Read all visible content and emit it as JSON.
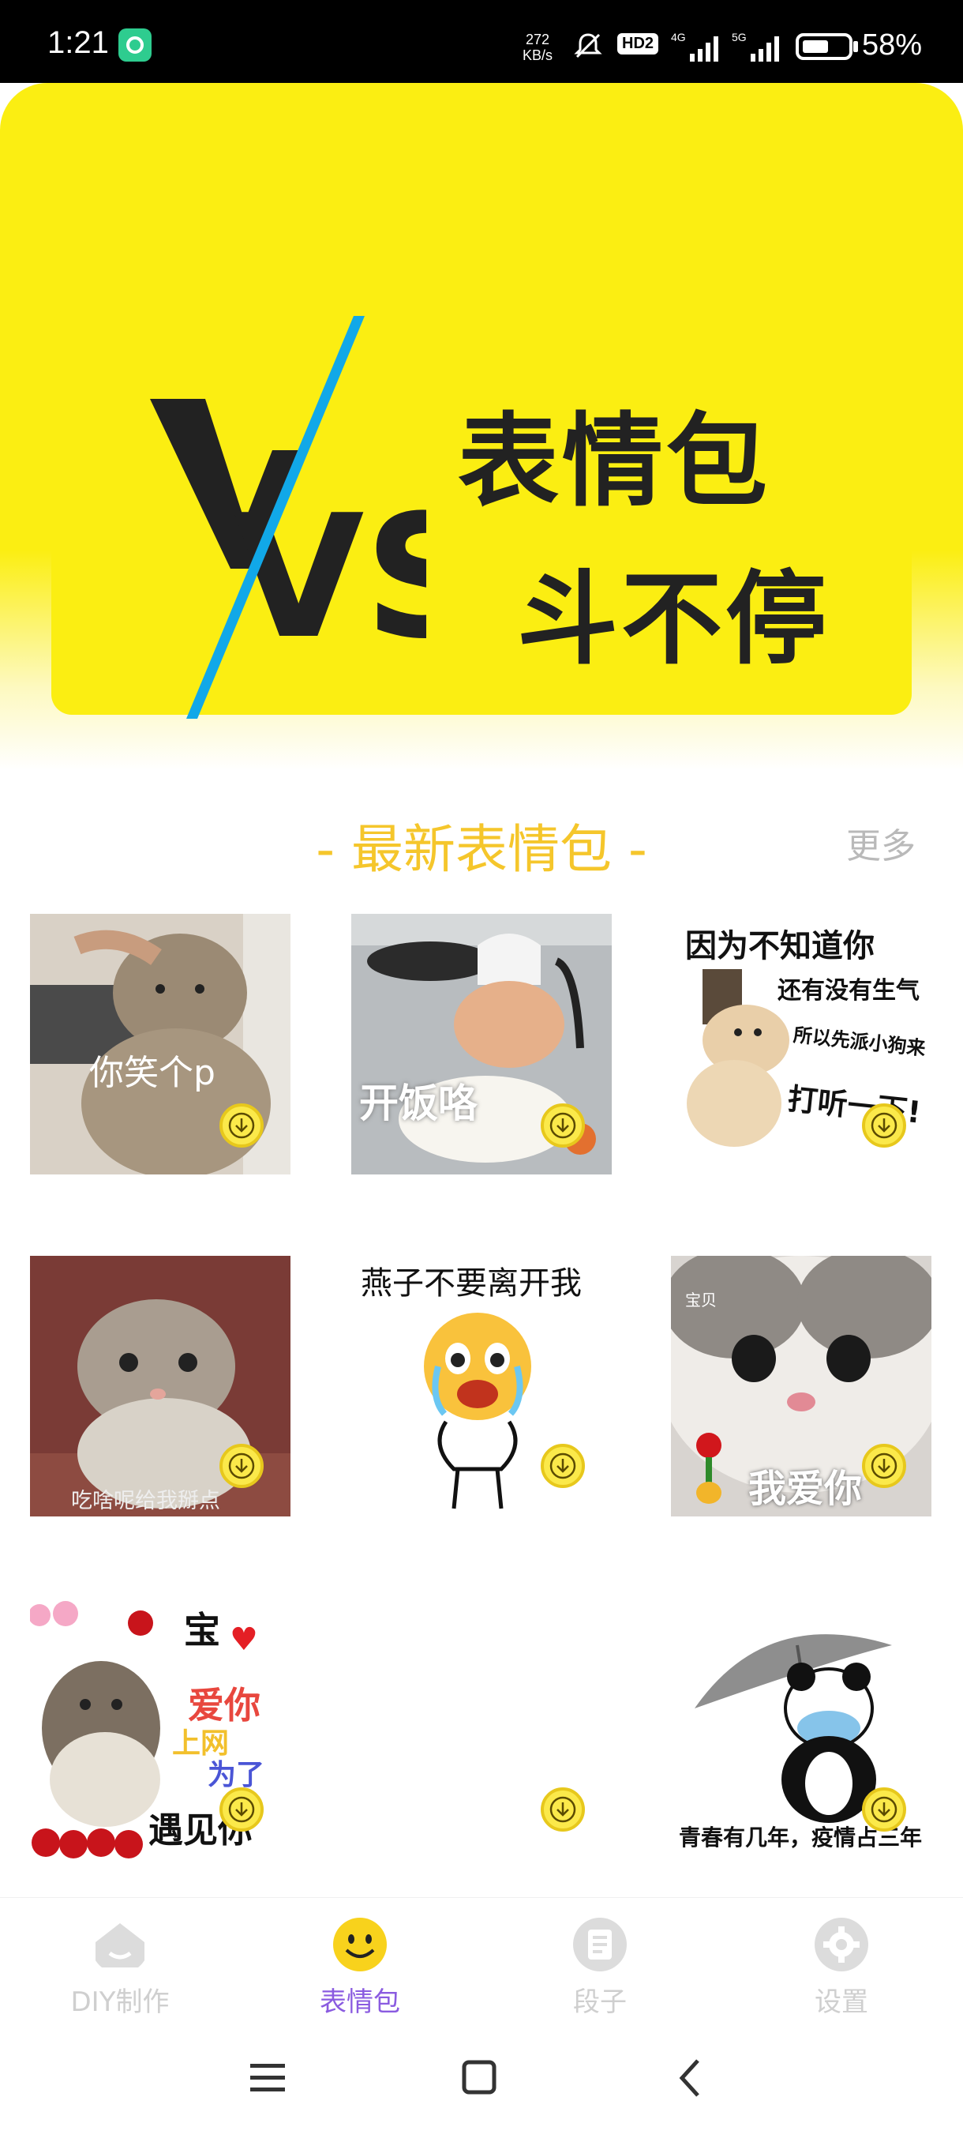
{
  "status_bar": {
    "time": "1:21",
    "net_speed_value": "272",
    "net_speed_unit": "KB/s",
    "hd_badge": "HD2",
    "sig1": "4G",
    "sig2": "5G",
    "battery_percent": "58%",
    "battery_level": 0.58
  },
  "banner": {
    "logo": "VS",
    "line1": "表情包",
    "line2": "斗不停"
  },
  "section": {
    "title": "- 最新表情包 -",
    "more": "更多"
  },
  "stickers": [
    {
      "caption": "你笑个p"
    },
    {
      "caption": "开饭咯"
    },
    {
      "caption_lines": [
        "因为不知道你",
        "还有没有生气",
        "所以先派小狗来",
        "打听一下!"
      ]
    },
    {
      "caption": "吃啥呢给我掰点"
    },
    {
      "caption": "燕子不要离开我"
    },
    {
      "caption_small": "宝贝",
      "caption": "我爱你"
    },
    {
      "caption_lines": [
        "宝",
        "爱你",
        "上网",
        "为了",
        "遇见你"
      ]
    },
    {
      "caption": ""
    },
    {
      "caption": "青春有几年，疫情占三年"
    }
  ],
  "bottom_nav": {
    "items": [
      {
        "label": "DIY制作",
        "icon": "home-icon",
        "active": false
      },
      {
        "label": "表情包",
        "icon": "smiley-icon",
        "active": true
      },
      {
        "label": "段子",
        "icon": "document-icon",
        "active": false
      },
      {
        "label": "设置",
        "icon": "gear-icon",
        "active": false
      }
    ]
  },
  "colors": {
    "banner_yellow": "#fbee12",
    "section_title": "#f5c62b",
    "active_nav": "#8a5be0",
    "inactive_nav": "#cfcfcf"
  }
}
